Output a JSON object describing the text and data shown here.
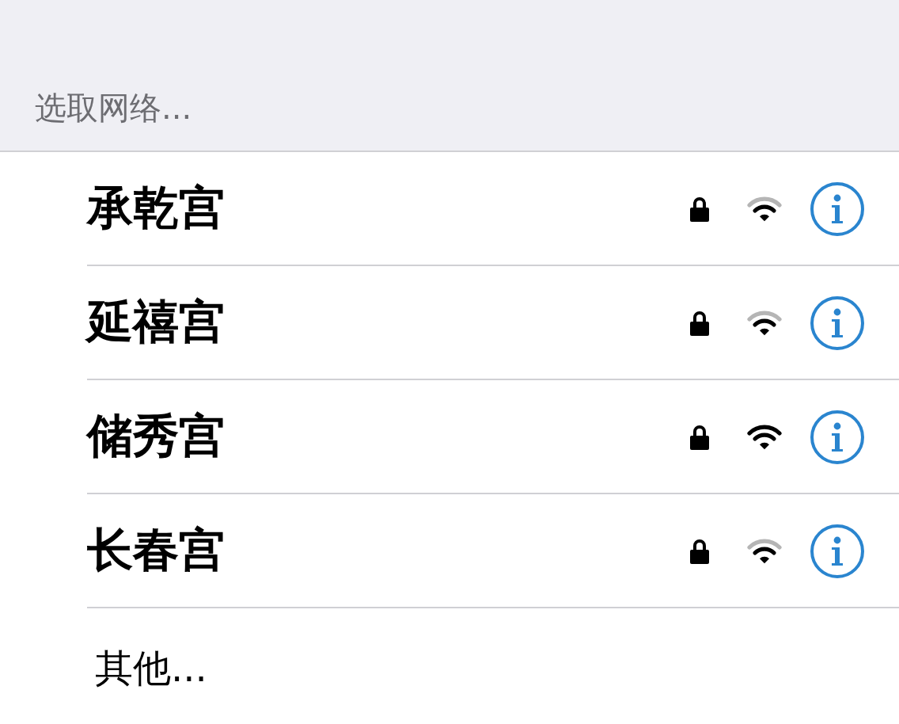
{
  "header": {
    "title": "选取网络..."
  },
  "networks": [
    {
      "name": "承乾宫",
      "locked": true,
      "full_signal": false
    },
    {
      "name": "延禧宫",
      "locked": true,
      "full_signal": false
    },
    {
      "name": "储秀宫",
      "locked": true,
      "full_signal": true
    },
    {
      "name": "长春宫",
      "locked": true,
      "full_signal": false
    }
  ],
  "other": {
    "label": "其他..."
  }
}
